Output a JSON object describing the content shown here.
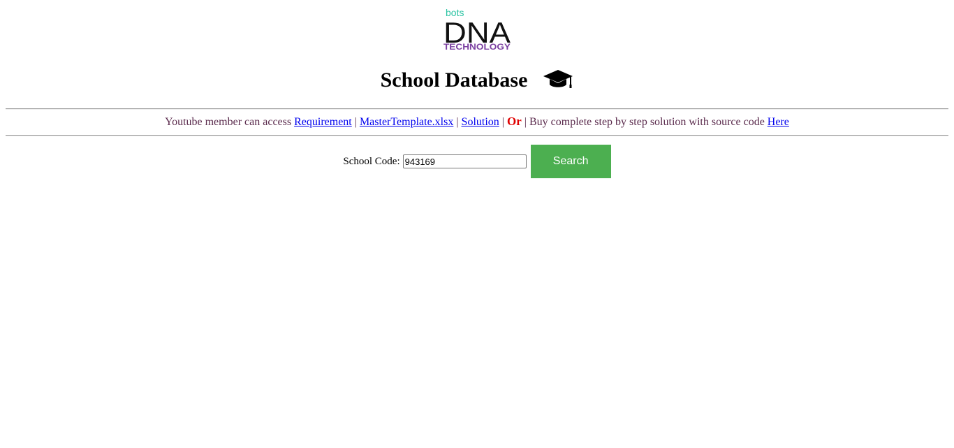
{
  "logo": {
    "top_text": "bots",
    "main_text": "DNA",
    "bottom_text": "TECHNOLOGY",
    "colors": {
      "top": "#2ec4a4",
      "main": "#111111",
      "bottom": "#7a3fa0"
    }
  },
  "header": {
    "title": "School Database",
    "icon": "graduation-cap-icon"
  },
  "notice": {
    "prefix": "Youtube member can access",
    "link_requirement": "Requirement",
    "sep1": "|",
    "link_master_template": "MasterTemplate.xlsx",
    "sep2": "|",
    "link_solution": "Solution",
    "sep3": "|",
    "or_text": "Or",
    "sep4": "|",
    "buy_text": "Buy complete step by step solution with source code",
    "link_here": "Here"
  },
  "search": {
    "label": "School Code:",
    "value": "943169",
    "button_label": "Search",
    "button_color": "#4caf50"
  }
}
